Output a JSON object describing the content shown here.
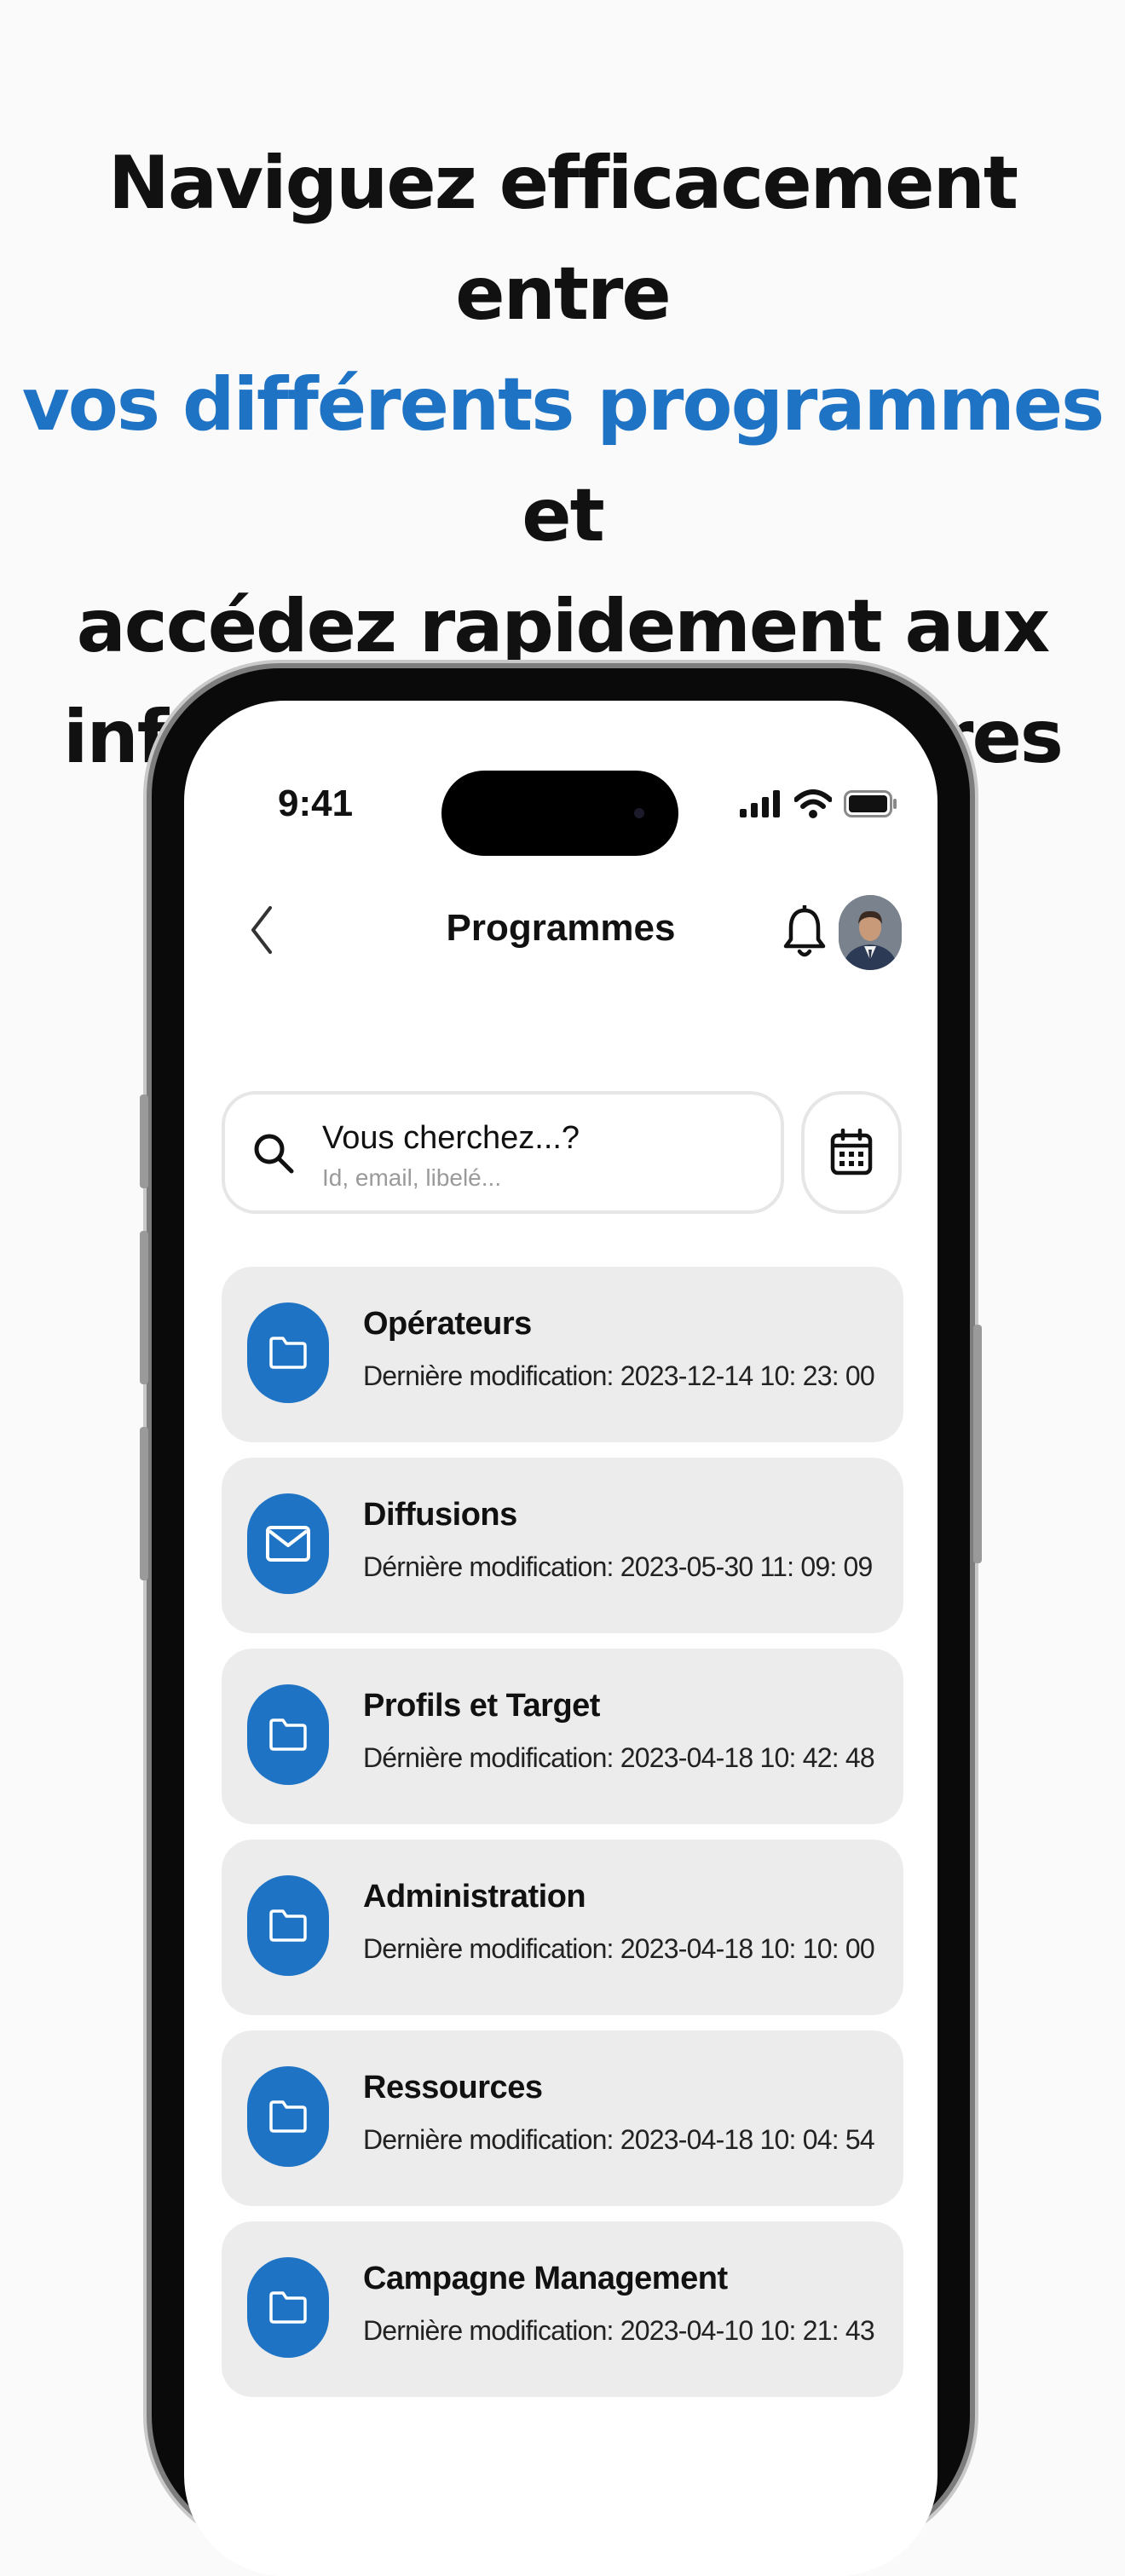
{
  "headline": {
    "line1": "Naviguez efficacement entre",
    "line2_accent": "vos différents programmes",
    "line2_rest": " et",
    "line3": "accédez rapidement aux",
    "line4": "informations nécessaires"
  },
  "colors": {
    "accent": "#1f73c5",
    "card_bg": "#ececec",
    "text": "#111111"
  },
  "status_bar": {
    "time": "9:41",
    "icons": [
      "signal-icon",
      "wifi-icon",
      "battery-icon"
    ]
  },
  "nav": {
    "title": "Programmes",
    "back_icon": "chevron-left-icon",
    "bell_icon": "bell-icon"
  },
  "search": {
    "title": "Vous cherchez...?",
    "placeholder": "Id, email, libelé...",
    "icon": "search-icon",
    "calendar_icon": "calendar-icon"
  },
  "programs": [
    {
      "title": "Opérateurs",
      "subtitle": "Dernière modification: 2023-12-14  10: 23: 00",
      "icon": "folder-icon"
    },
    {
      "title": "Diffusions",
      "subtitle": "Dérnière modification: 2023-05-30  11: 09: 09",
      "icon": "mail-icon"
    },
    {
      "title": "Profils et Target",
      "subtitle": "Dérnière modification: 2023-04-18  10: 42: 48",
      "icon": "folder-icon"
    },
    {
      "title": "Administration",
      "subtitle": "Dernière modification: 2023-04-18  10: 10: 00",
      "icon": "folder-icon"
    },
    {
      "title": "Ressources",
      "subtitle": "Dernière modification: 2023-04-18  10: 04: 54",
      "icon": "folder-icon"
    },
    {
      "title": "Campagne Management",
      "subtitle": "Dernière modification: 2023-04-10  10: 21: 43",
      "icon": "folder-icon"
    }
  ]
}
